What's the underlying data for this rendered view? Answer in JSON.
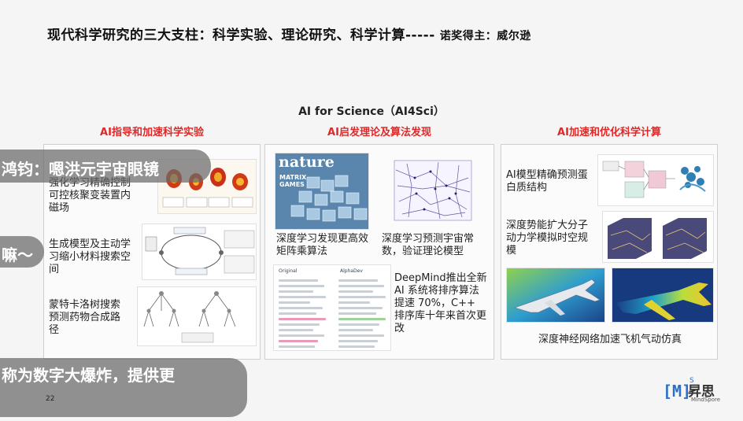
{
  "title": {
    "main": "现代科学研究的三大支柱：科学实验、理论研究、科学计算-----",
    "sub": "诺奖得主：威尔逊"
  },
  "center_label": "AI for Science（AI4Sci）",
  "columns": [
    {
      "heading": "AI指导和加速科学实验",
      "items": [
        "强化学习精确控制可控核聚变装置内磁场",
        "生成模型及主动学习缩小材料搜索空间",
        "蒙特卡洛树搜索预测药物合成路径"
      ]
    },
    {
      "heading": "AI启发理论及算法发现",
      "items": [
        "深度学习发现更高效矩阵乘算法",
        "深度学习预测宇宙常数，验证理论模型",
        "DeepMind推出全新 AI 系统将排序算法提速 70%，C++ 排序库十年来首次更改"
      ],
      "figure_text": {
        "nature": "nature",
        "matrix": "MATRIX",
        "games": "GAMES",
        "code_left": "Original",
        "code_right": "AlphaDev"
      }
    },
    {
      "heading": "AI加速和优化科学计算",
      "items": [
        "AI模型精确预测蛋白质结构",
        "深度势能扩大分子动力学模拟时空规模",
        "深度神经网络加速飞机气动仿真"
      ]
    }
  ],
  "overlays": {
    "caption1": "鸿钧：嗯洪元宇宙眼镜",
    "caption2": "嘛～",
    "caption3": "称为数字大爆炸，提供更"
  },
  "page_number": "22",
  "logo": {
    "mark": "[M]",
    "superscript": "S",
    "name": "昇思",
    "en": "MindSpore"
  },
  "colors": {
    "heading_red": "#e02828",
    "logo_blue": "#2a6fcb"
  }
}
